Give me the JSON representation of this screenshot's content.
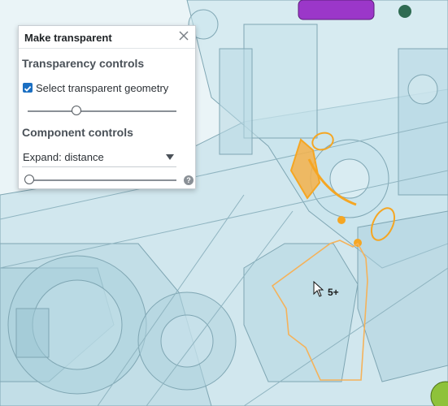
{
  "dialog": {
    "title": "Make transparent",
    "close_icon": "close-icon",
    "transparency_section": "Transparency controls",
    "select_transparent_label": "Select transparent geometry",
    "select_transparent_checked": true,
    "transparency_level": 0.33,
    "component_section": "Component controls",
    "expand_mode": "Expand: distance",
    "expand_distance_level": 0.0,
    "help_icon": "help-icon",
    "help_glyph": "?"
  },
  "viewport": {
    "selection_count": "5+",
    "cursor_icon": "arrow-cursor-icon",
    "highlight_color": "#f5a623",
    "model_color": "#bfe0ea"
  }
}
